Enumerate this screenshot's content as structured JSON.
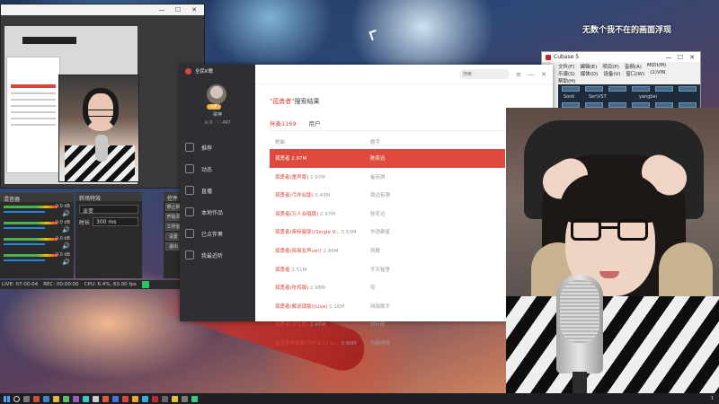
{
  "overlay": {
    "caption": "无数个我不在的画面浮现"
  },
  "obs": {
    "mixer_title": "混音器",
    "meters": [
      {
        "db": "0.0 dB"
      },
      {
        "db": "0.0 dB"
      },
      {
        "db": "0.0 dB"
      },
      {
        "db": "0.0 dB"
      }
    ],
    "transitions_title": "转场特效",
    "transition_select": "淡变",
    "duration_label": "时长",
    "duration_value": "300 ms",
    "controls_title": "控件",
    "controls": [
      "停止推流",
      "开始录制",
      "工作室模式",
      "设置",
      "退出"
    ],
    "status": {
      "live": "LIVE: 07:00:04",
      "rec": "REC: 00:00:00",
      "cpu": "CPU: 6.4%, 60.00 fps"
    }
  },
  "cubase": {
    "title": "Cubase 5",
    "menu": [
      "文件(F)",
      "编辑(E)",
      "项目(P)",
      "音频(A)",
      "MIDI(M)",
      "乐谱(S)",
      "媒体(D)",
      "设备(V)",
      "窗口(W)",
      "(1)VIN",
      "帮助(H)"
    ],
    "tracks": [
      "Sonk",
      "Ser\\VST",
      "yangbei"
    ]
  },
  "music_app": {
    "title": "全民K歌",
    "user": {
      "name": "歌神",
      "vip": "VIP",
      "stats": "⊙ 0 · ♡ 497"
    },
    "nav": [
      {
        "icon": "thumb-icon",
        "label": "推荐"
      },
      {
        "icon": "feed-icon",
        "label": "动态"
      },
      {
        "icon": "live-icon",
        "label": "直播"
      },
      {
        "icon": "local-icon",
        "label": "本地作品"
      },
      {
        "icon": "download-icon",
        "label": "已点伴奏"
      },
      {
        "icon": "recent-icon",
        "label": "我最近听"
      }
    ],
    "search_placeholder": "搜索",
    "search_title_keyword": "\"孤勇者\"",
    "search_title_suffix": "搜索结果",
    "tabs": [
      "伴奏1169",
      "用户"
    ],
    "col_song": "歌曲",
    "col_artist": "歌手",
    "results": [
      {
        "song": "孤勇者",
        "size": "2.97M",
        "artist": "陈奕迅",
        "selected": true
      },
      {
        "song": "孤勇者(童声版)",
        "size": "2.97M",
        "artist": "崔宛琪"
      },
      {
        "song": "孤勇者(弓作业版)",
        "size": "0.43M",
        "artist": "周边有限"
      },
      {
        "song": "孤勇者(万人合唱版)",
        "size": "2.97M",
        "artist": "陈奕迅"
      },
      {
        "song": "孤勇者(奥特曼版)(Single V...",
        "size": "0.53M",
        "artist": "华语群星"
      },
      {
        "song": "孤勇者(简易女声ver)",
        "size": "2.96M",
        "artist": "凯歌"
      },
      {
        "song": "孤勇者",
        "size": "2.51M",
        "artist": "齐天秘室"
      },
      {
        "song": "孤勇者(吃鸡版)",
        "size": "2.98M",
        "artist": "夸"
      },
      {
        "song": "孤勇者(解说现版)(Live)",
        "size": "0.16M",
        "artist": "网络歌手"
      },
      {
        "song": "孤勇者(学生版)",
        "size": "2.97M",
        "artist": "刘行政"
      },
      {
        "song": "孤勇者伴奏版(弓作业)(1.x)...",
        "size": "0.90M",
        "artist": "尔酷嘀嘀"
      }
    ]
  },
  "webcam": {
    "chair_logo": "oxa"
  },
  "taskbar": {
    "tray": "1"
  }
}
